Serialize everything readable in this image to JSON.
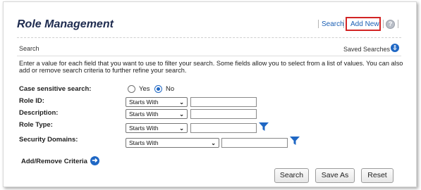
{
  "page": {
    "title": "Role Management",
    "links": {
      "search": "Search",
      "add_new": "Add New",
      "help_icon": "help-icon"
    }
  },
  "search_section": {
    "heading": "Search",
    "saved_searches": "Saved Searches",
    "instructions": "Enter a value for each field that you want to use to filter your search. Some fields allow you to select from a list of values. You can also add or remove search criteria to further refine your search."
  },
  "fields": {
    "case_sensitive": {
      "label": "Case sensitive search:",
      "options": [
        "Yes",
        "No"
      ],
      "selected": "No"
    },
    "role_id": {
      "label": "Role ID:",
      "operator": "Starts With",
      "value": ""
    },
    "description": {
      "label": "Description:",
      "operator": "Starts With",
      "value": ""
    },
    "role_type": {
      "label": "Role Type:",
      "operator": "Starts With",
      "value": ""
    },
    "security_domains": {
      "label": "Security Domains:",
      "operator": "Starts With",
      "value": ""
    }
  },
  "add_remove_criteria": "Add/Remove Criteria",
  "buttons": {
    "search": "Search",
    "save_as": "Save As",
    "reset": "Reset"
  },
  "colors": {
    "accent": "#1f67c4",
    "link": "#1a5fb4",
    "highlight_border": "#d22424",
    "title": "#1e2b4f"
  }
}
